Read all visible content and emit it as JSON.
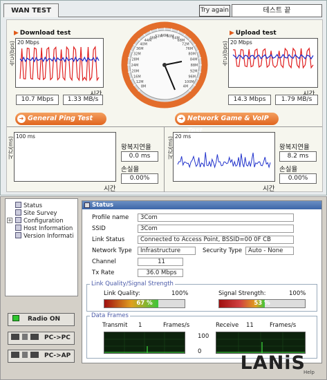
{
  "wan_test": {
    "tab_label": "WAN TEST",
    "try_again_label": "Try again",
    "status_text": "테스트 끝",
    "download": {
      "title": "Download test",
      "yaxis_label": "속도(bps)",
      "scale_label": "20 Mbps",
      "xaxis_label": "시간",
      "rate_bits": "10.7 Mbps",
      "rate_bytes": "1.33 MB/s",
      "line_colors": [
        "#e02020",
        "#2233cc"
      ]
    },
    "upload": {
      "title": "Upload test",
      "yaxis_label": "속도(bps)",
      "scale_label": "20 Mbps",
      "xaxis_label": "시간",
      "rate_bits": "14.3 Mbps",
      "rate_bytes": "1.79 MB/s",
      "line_colors": [
        "#e02020",
        "#2233cc"
      ]
    },
    "gauge": {
      "tick_labels": [
        "8M",
        "12M",
        "16M",
        "20M",
        "24M",
        "28M",
        "32M",
        "36M",
        "40M",
        "44M",
        "48M",
        "52M",
        "56M",
        "60M",
        "64M",
        "68M",
        "72M",
        "76M",
        "80M",
        "84M",
        "88M",
        "92M",
        "96M",
        "100M",
        "4M"
      ]
    },
    "ping": {
      "header": "General Ping Test",
      "yaxis_label": "시간(ms)",
      "scale_label": "100 ms",
      "xaxis_label": "시간",
      "rtt_label": "왕복지연율",
      "rtt_value": "0.0 ms",
      "loss_label": "손실율",
      "loss_value": "0.00%"
    },
    "game": {
      "header": "Network Game & VoIP Test",
      "yaxis_label": "시간(ms)",
      "scale_label": "20 ms",
      "xaxis_label": "시간",
      "rtt_label": "왕복지연율",
      "rtt_value": "8.2 ms",
      "loss_label": "손실율",
      "loss_value": "0.00%",
      "line_color": "#2233cc"
    }
  },
  "config": {
    "tree": [
      "Status",
      "Site Survey",
      "Configuration",
      "Host Information",
      "Version Informati"
    ],
    "radio_button": "Radio ON",
    "pc_pc_button": "PC->PC",
    "pc_ap_button": "PC->AP",
    "status": {
      "title": "Status",
      "profile_name_label": "Profile name",
      "profile_name": "3Com",
      "ssid_label": "SSID",
      "ssid": "3Com",
      "link_status_label": "Link Status",
      "link_status": "Connected to Access Point, BSSID=00 0F CB",
      "network_type_label": "Network Type",
      "network_type": "Infrastructure",
      "security_type_label": "Security Type",
      "security_type": "Auto - None",
      "channel_label": "Channel",
      "channel": "11",
      "tx_rate_label": "Tx Rate",
      "tx_rate": "36.0 Mbps",
      "quality_group": "Link Quality/Signal Strength",
      "link_quality_label": "Link Quality:",
      "link_quality_max": "100%",
      "link_quality_text": "67 %",
      "link_quality_fraction": 0.67,
      "signal_label": "Signal Strength:",
      "signal_max": "100%",
      "signal_text": "53 %",
      "signal_fraction": 0.53,
      "frames_group": "Data Frames",
      "transmit_label": "Transmit",
      "transmit_value": "1",
      "transmit_unit": "Frames/s",
      "receive_label": "Receive",
      "receive_value": "11",
      "receive_unit": "Frames/s",
      "scale_max": "100",
      "scale_min": "0"
    },
    "logo": "LANiS",
    "help_label": "Help"
  }
}
